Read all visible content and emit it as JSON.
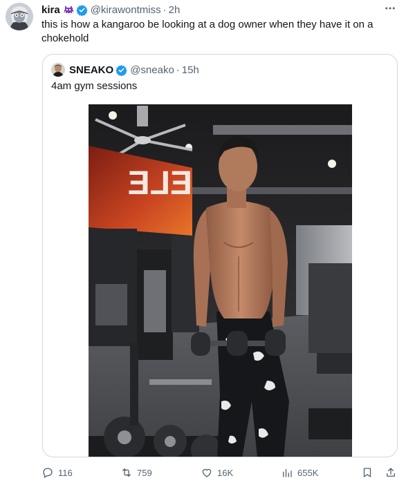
{
  "tweet": {
    "author_name": "kira",
    "author_handle": "@kirawontmiss",
    "separator": "·",
    "time": "2h",
    "text": "this is how a kangaroo be looking at a dog owner when they have it on a chokehold"
  },
  "quote": {
    "author_name": "SNEAKO",
    "author_handle": "@sneako",
    "separator": "·",
    "time": "15h",
    "text": "4am gym sessions"
  },
  "actions": {
    "replies": "116",
    "reposts": "759",
    "likes": "16K",
    "views": "655K"
  },
  "colors": {
    "verified": "#1d9bf0",
    "emoji": "#7b3fbf",
    "muted": "#536471",
    "border": "#cfd9de"
  },
  "icons": [
    "more-icon",
    "verified-badge-icon",
    "reply-icon",
    "repost-icon",
    "like-icon",
    "views-icon",
    "bookmark-icon",
    "share-icon"
  ]
}
